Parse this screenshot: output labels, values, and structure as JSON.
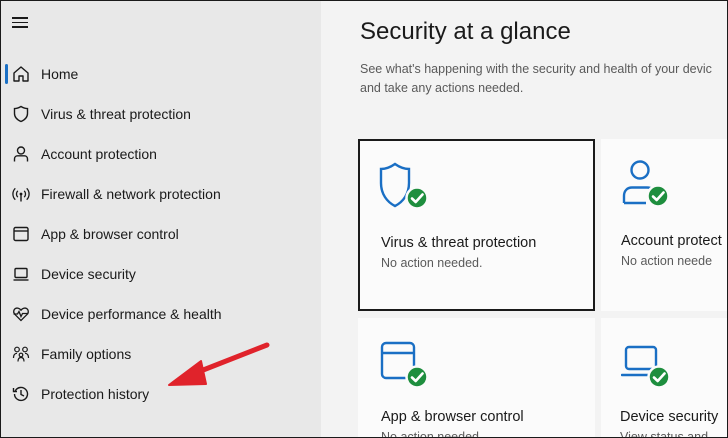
{
  "sidebar": {
    "items": [
      {
        "label": "Home",
        "icon": "home-icon"
      },
      {
        "label": "Virus & threat protection",
        "icon": "shield-icon"
      },
      {
        "label": "Account protection",
        "icon": "person-icon"
      },
      {
        "label": "Firewall & network protection",
        "icon": "wifi-icon"
      },
      {
        "label": "App & browser control",
        "icon": "browser-window-icon"
      },
      {
        "label": "Device security",
        "icon": "laptop-icon"
      },
      {
        "label": "Device performance & health",
        "icon": "heart-pulse-icon"
      },
      {
        "label": "Family options",
        "icon": "family-icon"
      },
      {
        "label": "Protection history",
        "icon": "history-icon"
      }
    ]
  },
  "main": {
    "title": "Security at a glance",
    "subtitle_line1": "See what's happening with the security and health of your devic",
    "subtitle_line2": "and take any actions needed.",
    "cards": [
      {
        "name": "Virus & threat protection",
        "status": "No action needed.",
        "icon": "shield-check-icon"
      },
      {
        "name": "Account protect",
        "status": "No action neede",
        "icon": "person-check-icon"
      },
      {
        "name": "App & browser control",
        "status": "No action needed.",
        "icon": "browser-check-icon"
      },
      {
        "name": "Device security",
        "status": "View status and",
        "icon": "laptop-check-icon"
      }
    ]
  },
  "colors": {
    "accent": "#1a6fc4",
    "ok_green": "#1e8e3e",
    "annotation_arrow": "#e0232b"
  }
}
